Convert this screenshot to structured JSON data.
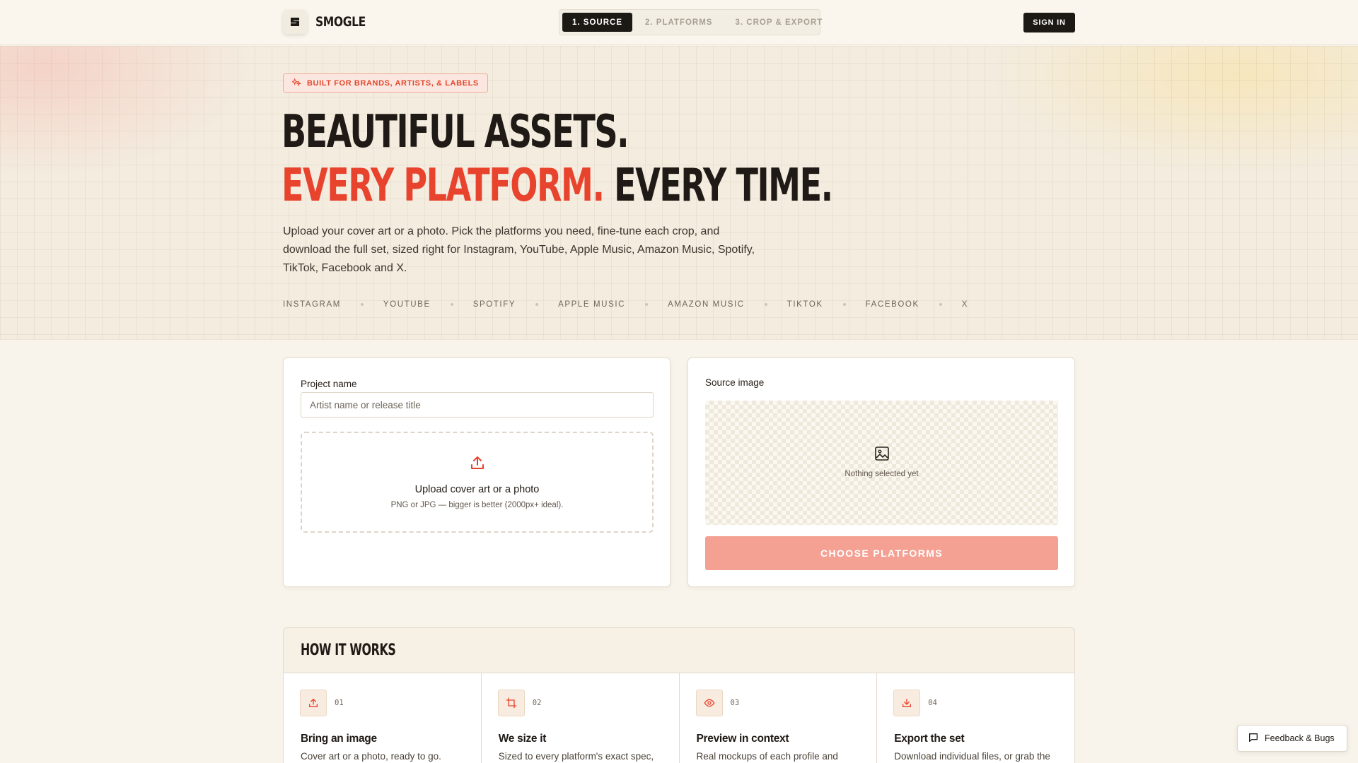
{
  "header": {
    "brand": "SMOGLE",
    "steps": [
      "1. SOURCE",
      "2. PLATFORMS",
      "3. CROP & EXPORT"
    ],
    "sign_in": "SIGN IN"
  },
  "hero": {
    "badge": "BUILT FOR BRANDS, ARTISTS, & LABELS",
    "headline_line1": "BEAUTIFUL ASSETS.",
    "headline_red": "EVERY PLATFORM.",
    "headline_dark": "EVERY TIME.",
    "subtext": "Upload your cover art or a photo. Pick the platforms you need, fine-tune each crop, and download the full set, sized right for Instagram, YouTube, Apple Music, Amazon Music, Spotify, TikTok, Facebook and X.",
    "platforms": [
      "INSTAGRAM",
      "YOUTUBE",
      "SPOTIFY",
      "APPLE MUSIC",
      "AMAZON MUSIC",
      "TIKTOK",
      "FACEBOOK",
      "X"
    ]
  },
  "project": {
    "label": "Project name",
    "placeholder": "Artist name or release title",
    "value": "",
    "upload_title": "Upload cover art or a photo",
    "upload_sub": "PNG or JPG — bigger is better (2000px+ ideal)."
  },
  "source": {
    "label": "Source image",
    "empty_text": "Nothing selected yet",
    "choose_button": "CHOOSE PLATFORMS"
  },
  "how": {
    "title": "HOW IT WORKS",
    "steps": [
      {
        "num": "01",
        "title": "Bring an image",
        "desc": "Cover art or a photo, ready to go.",
        "icon": "upload-icon"
      },
      {
        "num": "02",
        "title": "We size it",
        "desc": "Sized to every platform's exact spec,",
        "icon": "crop-icon"
      },
      {
        "num": "03",
        "title": "Preview in context",
        "desc": "Real mockups of each profile and",
        "icon": "eye-icon"
      },
      {
        "num": "04",
        "title": "Export the set",
        "desc": "Download individual files, or grab the",
        "icon": "download-icon"
      }
    ]
  },
  "feedback": {
    "label": "Feedback & Bugs"
  },
  "colors": {
    "accent": "#e8432d",
    "dark": "#1c1915",
    "button_disabled": "#f4a093",
    "background": "#f8f4eb"
  }
}
